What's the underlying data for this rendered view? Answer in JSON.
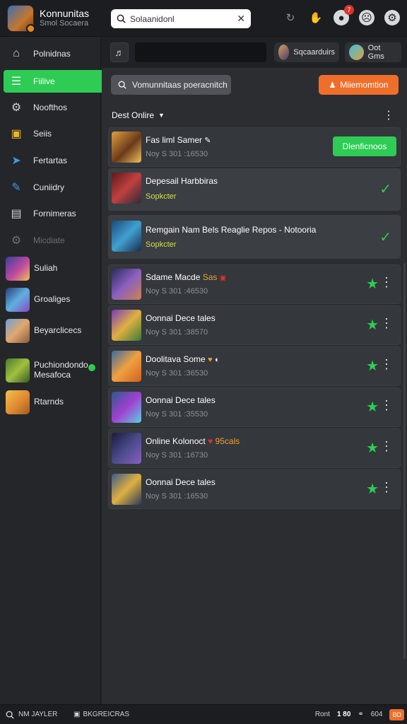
{
  "app": {
    "title": "Konnunitas",
    "subtitle": "Smol Socaera"
  },
  "search": {
    "placeholder": "Solaanidonl"
  },
  "notifications": {
    "count": "7"
  },
  "sidebar": {
    "items": [
      {
        "label": "Polnidnas",
        "icon": "home-icon"
      },
      {
        "label": "Fiilive",
        "icon": "list-icon"
      },
      {
        "label": "Noofthos",
        "icon": "gear-icon"
      },
      {
        "label": "Seiis",
        "icon": "bag-icon"
      },
      {
        "label": "Fertartas",
        "icon": "send-icon"
      },
      {
        "label": "Cuniidry",
        "icon": "brush-icon"
      },
      {
        "label": "Fornimeras",
        "icon": "document-icon"
      },
      {
        "label": "Micdiate",
        "icon": "gear-icon"
      }
    ],
    "games": [
      {
        "label": "Suliah"
      },
      {
        "label": "Groaliges"
      },
      {
        "label": "Beyarclicecs"
      },
      {
        "label": "Puchiondondo Mesafoca"
      },
      {
        "label": "Rtarnds"
      }
    ]
  },
  "subbar": {
    "chip1": "Sqcaarduirs",
    "chip2": "Oot Gms"
  },
  "actions": {
    "gray_button": "Vomunnitaas poeracnitch",
    "orange_button": "Miiemomtion"
  },
  "section": {
    "heading": "Dest Onlire"
  },
  "rows": [
    {
      "title": "Fas liml Samer",
      "meta": "Noy S 301 :16530",
      "cta": "Dlenficnoos"
    },
    {
      "title": "Depesail Harbbiras",
      "sub": "Sopkcter"
    },
    {
      "title": "Remgain Nam Bels Reaglie Repos - Notooria",
      "sub": "Sopkcter"
    },
    {
      "title": "Sdame Macde",
      "title_accent": "Sas",
      "meta": "Noy S 301 :46530"
    },
    {
      "title": "Oonnai Dece tales",
      "meta": "Noy S 301 :38570"
    },
    {
      "title": "Doolitava Some",
      "meta": "Noy S 301 :36530"
    },
    {
      "title": "Oonnai Dece tales",
      "meta": "Noy S 301 :35530"
    },
    {
      "title": "Online Kolonoct",
      "title_accent": "95cals",
      "meta": "Noy S 301 :16730"
    },
    {
      "title": "Oonnai Dece tales",
      "meta": "Noy S 301 :16530"
    }
  ],
  "bottombar": {
    "left": "NM JAYLER",
    "mid": "BKGREICRAS",
    "right_label": "Ront",
    "right_num": "1 80",
    "right_num2": "604",
    "right_badge": "BD"
  },
  "colors": {
    "accent_green": "#2ecc55",
    "accent_orange": "#ef6f2a",
    "badge_red": "#e0312b"
  }
}
